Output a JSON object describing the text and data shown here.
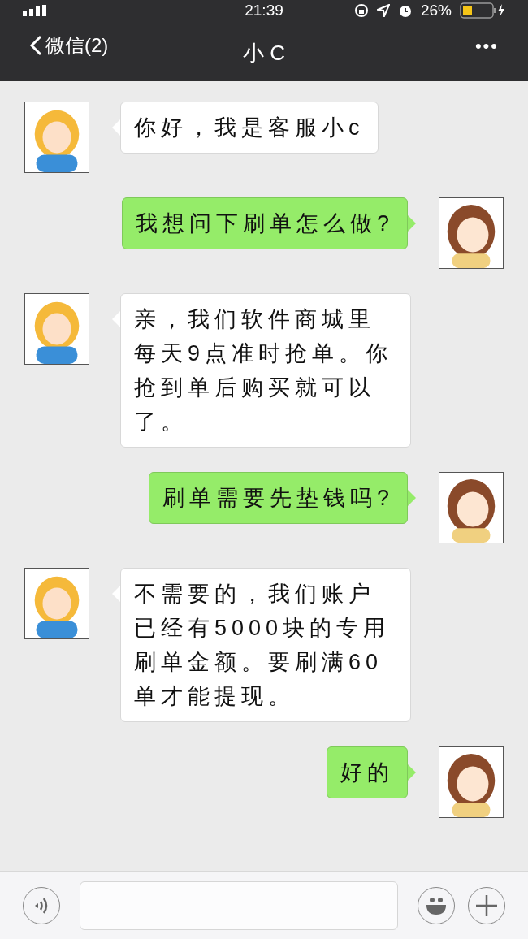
{
  "status_bar": {
    "time": "21:39",
    "battery": "26%"
  },
  "nav": {
    "back": "微信(2)",
    "title": "小 C",
    "more": "•••"
  },
  "messages": [
    {
      "kind": "incoming",
      "text": "你好，我是客服小c"
    },
    {
      "kind": "outgoing",
      "text": "我想问下刷单怎么做?"
    },
    {
      "kind": "incoming",
      "text": "亲，我们软件商城里每天9点准时抢单。你抢到单后购买就可以了。"
    },
    {
      "kind": "outgoing",
      "text": "刷单需要先垫钱吗?"
    },
    {
      "kind": "incoming",
      "text": "不需要的，我们账户已经有5000块的专用刷单金额。要刷满60单才能提现。"
    },
    {
      "kind": "outgoing",
      "text": "好的"
    }
  ]
}
